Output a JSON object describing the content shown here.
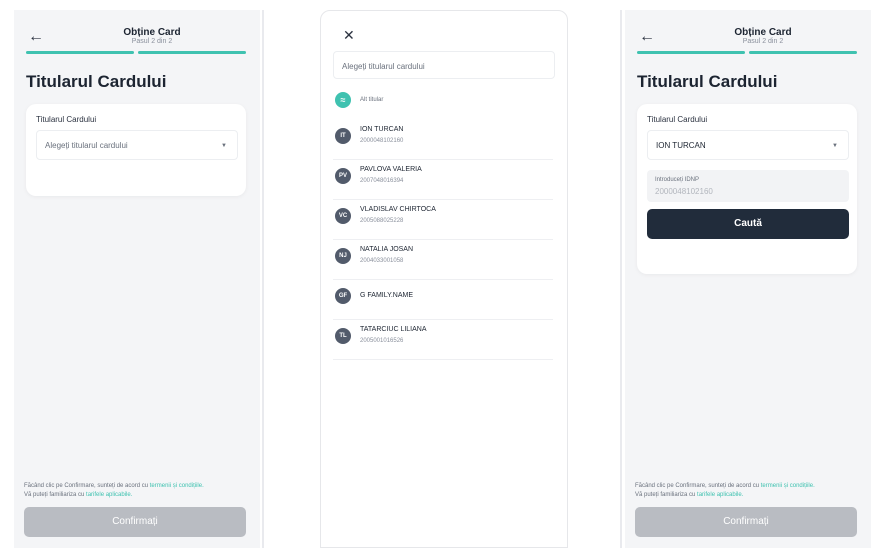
{
  "header": {
    "title": "Obține Card",
    "step": "Pasul 2 din 2"
  },
  "page_title": "Titularul Cardului",
  "card_label": "Titularul Cardului",
  "select_placeholder": "Alegeți titularul cardului",
  "selected_holder": "ION TURCAN",
  "idnp": {
    "label": "Introduceți IDNP",
    "value": "2000048102160"
  },
  "search_button": "Caută",
  "terms": {
    "prefix": "Făcând clic pe Confirmare, sunteți de acord cu ",
    "link1": "termenii și condițiile.",
    "line2_prefix": "Vă puteți familiariza cu ",
    "link2": "tarifele aplicabile."
  },
  "confirm_button": "Confirmați",
  "modal": {
    "search_placeholder": "Alegeți titularul cardului",
    "alt_label": "Alt titular",
    "holders": [
      {
        "initials": "IT",
        "name": "ION TURCAN",
        "id": "2000048102160"
      },
      {
        "initials": "PV",
        "name": "PAVLOVA VALERIA",
        "id": "2007048016394"
      },
      {
        "initials": "VC",
        "name": "VLADISLAV CHIRTOCA",
        "id": "2005088025228"
      },
      {
        "initials": "NJ",
        "name": "NATALIA JOSAN",
        "id": "2004033001058"
      },
      {
        "initials": "GF",
        "name": "G FAMILY.NAME",
        "id": ""
      },
      {
        "initials": "TL",
        "name": "TATARCIUC LILIANA",
        "id": "2005001016526"
      }
    ]
  },
  "colors": {
    "accent": "#3fc2b0",
    "dark_button": "#212c3b",
    "disabled_button": "#b9bcc2"
  }
}
